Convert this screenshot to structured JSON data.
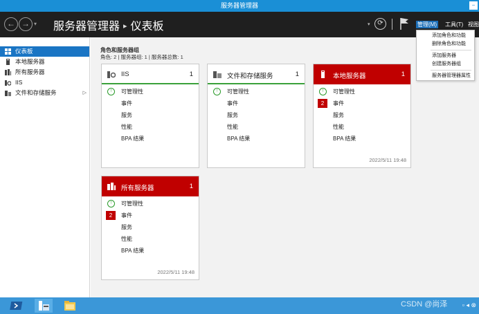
{
  "window": {
    "title": "服务器管理器"
  },
  "header": {
    "breadcrumb_app": "服务器管理器",
    "breadcrumb_page": "仪表板",
    "menus": {
      "manage": "管理(M)",
      "tools": "工具(T)",
      "view": "视图"
    }
  },
  "sidebar": {
    "items": [
      {
        "label": "仪表板",
        "icon": "dashboard-icon",
        "active": true
      },
      {
        "label": "本地服务器",
        "icon": "server-icon",
        "active": false
      },
      {
        "label": "所有服务器",
        "icon": "servers-icon",
        "active": false
      },
      {
        "label": "IIS",
        "icon": "iis-icon",
        "active": false
      },
      {
        "label": "文件和存储服务",
        "icon": "storage-icon",
        "active": false,
        "has_children": true
      }
    ]
  },
  "main": {
    "section_title": "角色和服务器组",
    "section_subtitle": "角色: 2 | 服务器组: 1 | 服务器总数: 1"
  },
  "tiles": [
    {
      "title": "IIS",
      "count": "1",
      "alert": false,
      "manageability": "可管理性",
      "events": "事件",
      "services": "服务",
      "performance": "性能",
      "bpa": "BPA 结果",
      "timestamp": ""
    },
    {
      "title": "文件和存储服务",
      "count": "1",
      "alert": false,
      "manageability": "可管理性",
      "events": "事件",
      "services": "服务",
      "performance": "性能",
      "bpa": "BPA 结果",
      "timestamp": ""
    },
    {
      "title": "本地服务器",
      "count": "1",
      "alert": true,
      "manageability": "可管理性",
      "events": "事件",
      "events_badge": "2",
      "services": "服务",
      "performance": "性能",
      "bpa": "BPA 结果",
      "timestamp": "2022/5/11 19:48"
    },
    {
      "title": "所有服务器",
      "count": "1",
      "alert": true,
      "manageability": "可管理性",
      "events": "事件",
      "events_badge": "2",
      "services": "服务",
      "performance": "性能",
      "bpa": "BPA 结果",
      "timestamp": "2022/5/11 19:48"
    }
  ],
  "manage_menu": {
    "items": [
      "添加角色和功能",
      "删除角色和功能",
      "添加服务器",
      "创建服务器组",
      "服务器管理器属性"
    ]
  },
  "taskbar": {
    "watermark": "CSDN @尚泽"
  },
  "colors": {
    "accent": "#1a75c4",
    "alert": "#c00000",
    "ok": "#3aa13a",
    "header_bg": "#1f1f1f",
    "taskbar": "#3b97d8"
  }
}
